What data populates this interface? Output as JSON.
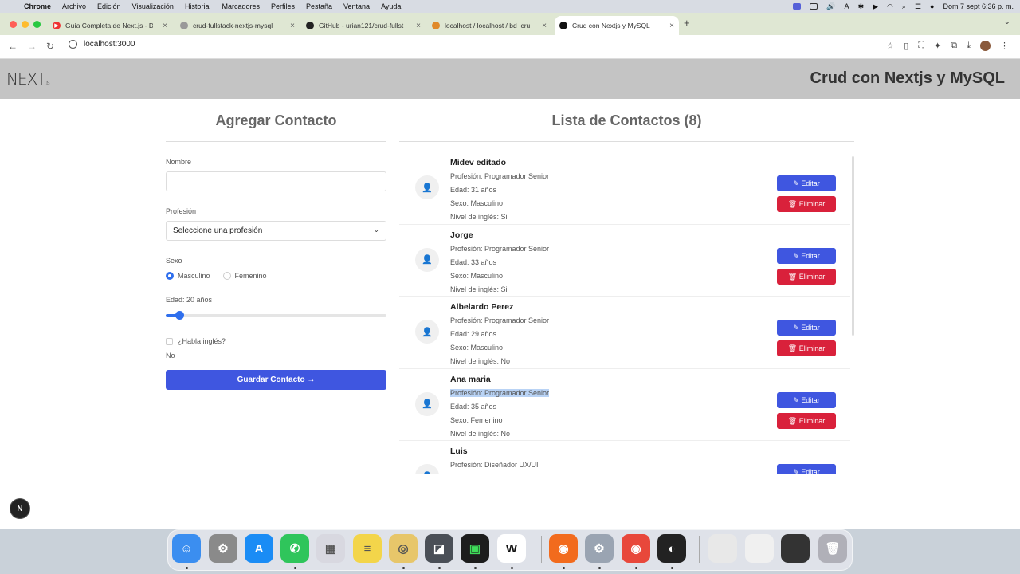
{
  "menubar": {
    "app": "Chrome",
    "items": [
      "Archivo",
      "Edición",
      "Visualización",
      "Historial",
      "Marcadores",
      "Perfiles",
      "Pestaña",
      "Ventana",
      "Ayuda"
    ],
    "clock": "Dom 7 sept 6:36 p. m."
  },
  "browser": {
    "tabs": [
      {
        "title": "Guía Completa de Next.js - D",
        "icon": "youtube-icon"
      },
      {
        "title": "crud-fullstack-nextjs-mysql",
        "icon": "globe-icon"
      },
      {
        "title": "GitHub - urian121/crud-fullst",
        "icon": "github-icon"
      },
      {
        "title": "localhost / localhost / bd_cru",
        "icon": "phpmyadmin-icon"
      },
      {
        "title": "Crud con Nextjs y MySQL",
        "icon": "nextjs-icon"
      }
    ],
    "url": "localhost:3000"
  },
  "header": {
    "logo": "NEXT",
    "logo_suffix": ".JS",
    "title": "Crud con Nextjs y MySQL"
  },
  "form": {
    "title": "Agregar Contacto",
    "name_label": "Nombre",
    "name_value": "",
    "profession_label": "Profesión",
    "profession_value": "Seleccione una profesión",
    "sex_label": "Sexo",
    "sex_options": [
      "Masculino",
      "Femenino"
    ],
    "sex_selected": "Masculino",
    "age_label": "Edad: 20 años",
    "age_fraction": 0.06,
    "english_label": "¿Habla inglés?",
    "english_value": "No",
    "submit_label": "Guardar Contacto"
  },
  "list": {
    "title": "Lista de Contactos (8)",
    "edit_label": "Editar",
    "delete_label": "Eliminar",
    "contacts": [
      {
        "name": "Midev editado",
        "profession": "Profesión: Programador Senior",
        "age": "Edad: 31 años",
        "sex": "Sexo: Masculino",
        "english": "Nivel de inglés: Si"
      },
      {
        "name": "Jorge",
        "profession": "Profesión: Programador Senior",
        "age": "Edad: 33 años",
        "sex": "Sexo: Masculino",
        "english": "Nivel de inglés: Si"
      },
      {
        "name": "Albelardo Perez",
        "profession": "Profesión: Programador Senior",
        "age": "Edad: 29 años",
        "sex": "Sexo: Masculino",
        "english": "Nivel de inglés: No"
      },
      {
        "name": "Ana maria",
        "profession": "Profesión: Programador Senior",
        "age": "Edad: 35 años",
        "sex": "Sexo: Femenino",
        "english": "Nivel de inglés: No"
      },
      {
        "name": "Luis",
        "profession": "Profesión: Diseñador UX/UI",
        "age": "",
        "sex": "",
        "english": ""
      }
    ]
  },
  "devtools_badge": "N",
  "dock": {
    "apps": [
      "finder-icon",
      "system-settings-icon",
      "app-store-icon",
      "whatsapp-icon",
      "launchpad-icon",
      "notes-icon",
      "sequel-icon",
      "dbngin-icon",
      "terminal-icon",
      "notion-icon",
      "firefox-icon",
      "preview-icon",
      "chrome-icon",
      "obs-icon",
      "window-thumbnail-icon",
      "window-thumbnail-icon",
      "window-thumbnail-icon",
      "trash-icon"
    ]
  }
}
